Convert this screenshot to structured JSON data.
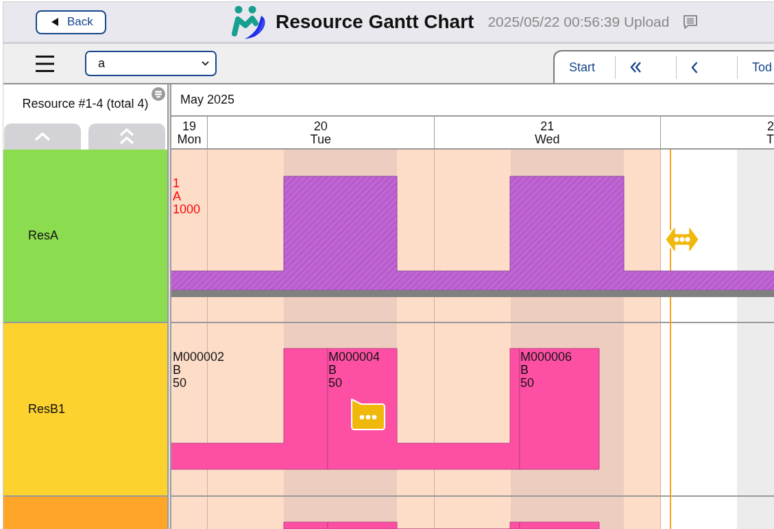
{
  "header": {
    "back_button": "Back",
    "title": "Resource Gantt Chart",
    "upload_info": "2025/05/22 00:56:39 Upload"
  },
  "toolbar": {
    "filter_select": {
      "value": "a"
    },
    "nav_buttons": [
      {
        "kind": "text",
        "label": "Start"
      },
      {
        "kind": "double"
      },
      {
        "kind": "single"
      },
      {
        "kind": "text",
        "label": "Tod"
      }
    ]
  },
  "resource_panel": {
    "title": "Resource #1-4 (total 4)"
  },
  "timeline": {
    "month": "May 2025",
    "days": [
      {
        "date": "19",
        "weekday": "Mon",
        "past": true
      },
      {
        "date": "20",
        "weekday": "Tue",
        "past": true
      },
      {
        "date": "21",
        "weekday": "Wed",
        "past": true
      },
      {
        "date": "2",
        "weekday": "T",
        "past": false
      }
    ]
  },
  "resources": [
    {
      "name": "ResA",
      "color": "#8cdc50",
      "bars": [
        {
          "kind": "load",
          "label": [
            "1",
            "A",
            "1000"
          ]
        }
      ]
    },
    {
      "name": "ResB1",
      "color": "#fdd22e",
      "bars": [
        {
          "kind": "task",
          "label": [
            "M000002",
            "B",
            "50"
          ]
        },
        {
          "kind": "task",
          "label": [
            "M000004",
            "B",
            "50"
          ]
        },
        {
          "kind": "task",
          "label": [
            "M000006",
            "B",
            "50"
          ]
        }
      ]
    },
    {
      "color": "#ffa52a",
      "bars": [
        {
          "kind": "task"
        },
        {
          "kind": "task"
        },
        {
          "kind": "task"
        }
      ]
    }
  ]
}
